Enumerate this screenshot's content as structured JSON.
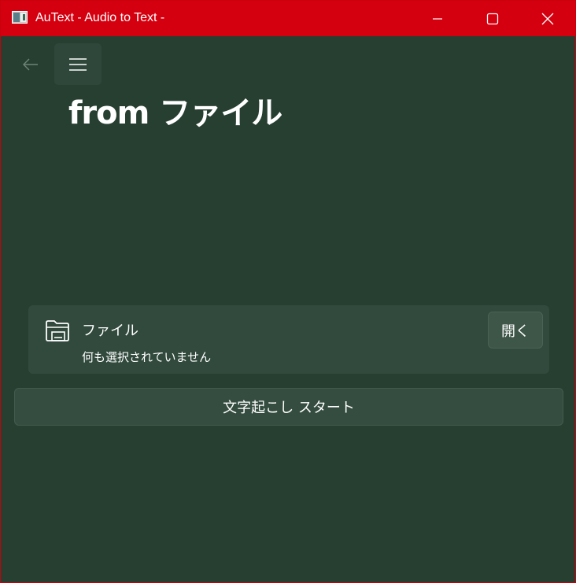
{
  "window": {
    "title": "AuText - Audio to Text -",
    "accent_color": "#d5000f",
    "background_color": "#273f31"
  },
  "caption_buttons": {
    "minimize_icon": "minimize-icon",
    "maximize_icon": "maximize-icon",
    "close_icon": "close-icon"
  },
  "nav": {
    "back_icon": "back-arrow-icon",
    "menu_icon": "hamburger-menu-icon"
  },
  "page": {
    "title": "from ファイル"
  },
  "file_card": {
    "icon": "folder-open-icon",
    "label": "ファイル",
    "status": "何も選択されていません",
    "open_button": "開く"
  },
  "actions": {
    "start_button": "文字起こし スタート"
  }
}
